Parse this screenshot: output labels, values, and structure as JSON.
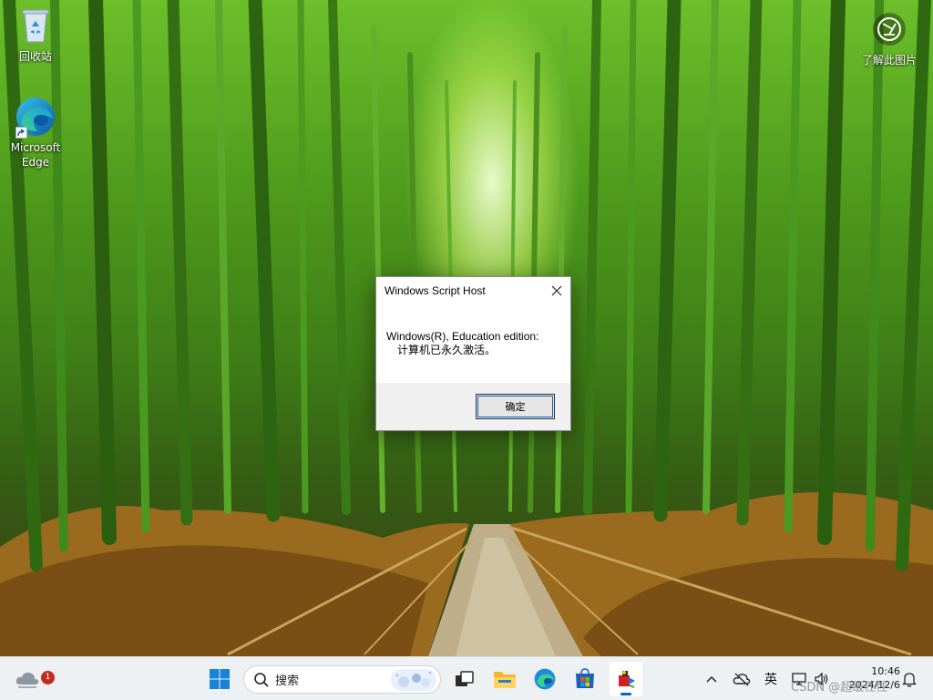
{
  "desktop": {
    "icons": [
      {
        "label": "回收站"
      },
      {
        "label_line1": "Microsoft",
        "label_line2": "Edge"
      }
    ],
    "spotlight_label": "了解此图片"
  },
  "dialog": {
    "title": "Windows Script Host",
    "message_line1": "Windows(R), Education edition:",
    "message_line2": "计算机已永久激活。",
    "ok_label": "确定"
  },
  "taskbar": {
    "weather_badge": "1",
    "search_placeholder": "搜索",
    "pinned": [
      "start-icon",
      "task-view-icon",
      "file-explorer-icon",
      "edge-icon",
      "store-icon",
      "script-app-icon"
    ],
    "tray": {
      "ime_label": "英",
      "time": "10:46",
      "date": "2024/12/6"
    },
    "watermark": "CSDN @超级任性"
  },
  "colors": {
    "accent": "#0a64c8",
    "badge": "#c42b1c",
    "taskbar_bg": "#eef1f4"
  }
}
